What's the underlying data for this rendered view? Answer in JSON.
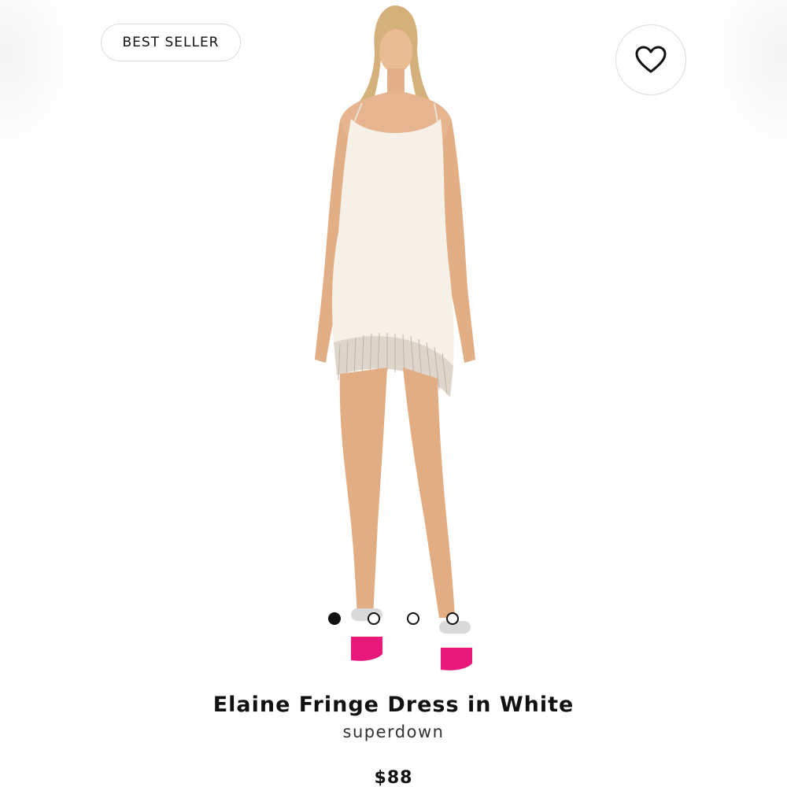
{
  "badge": {
    "label": "BEST SELLER"
  },
  "favorite": {
    "icon": "heart-outline-icon",
    "selected": false
  },
  "product": {
    "image": {
      "subject": "model wearing white fringe mini dress with pink heels",
      "dress_color": "#f6f1e7",
      "shoe_color": "#e8197a"
    },
    "name": "Elaine Fringe Dress in White",
    "brand": "superdown",
    "price": "$88"
  },
  "carousel": {
    "total_slides": 4,
    "active_index": 0,
    "active_color": "#111111"
  }
}
